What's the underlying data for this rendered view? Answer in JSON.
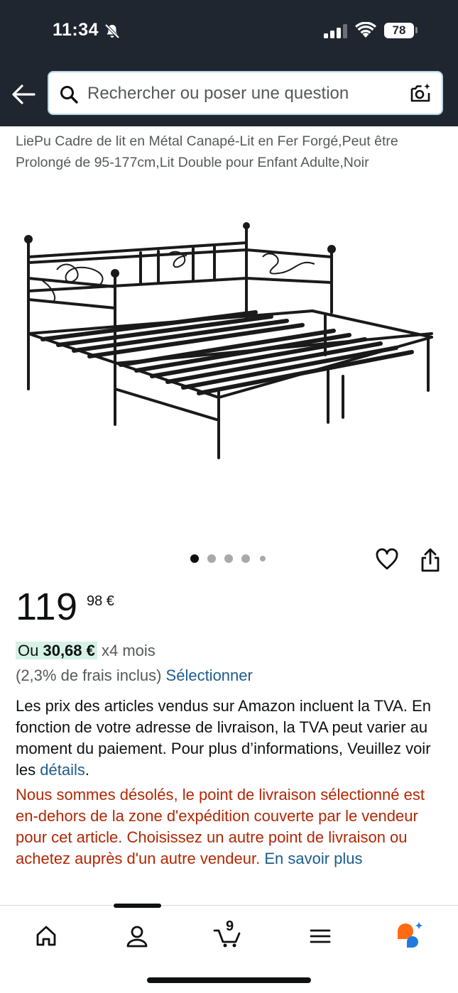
{
  "status_bar": {
    "time": "11:34",
    "battery": "78"
  },
  "search": {
    "placeholder": "Rechercher ou poser une question"
  },
  "product": {
    "title": "LiePu Cadre de lit en Métal Canapé-Lit en Fer Forgé,Peut être Prolongé de 95-177cm,Lit Double pour Enfant Adulte,Noir",
    "image_count": 5,
    "image_index": 1
  },
  "price": {
    "whole": "119",
    "cents": "98 €"
  },
  "installment": {
    "prefix": "Ou ",
    "amount": "30,68 €",
    "suffix": " x4 mois",
    "fees": "(2,3% de frais inclus) ",
    "select_link": "Sélectionner"
  },
  "vat_notice": {
    "text": "Les prix des articles vendus sur Amazon incluent la TVA. En fonction de votre adresse de livraison, la TVA peut varier au moment du paiement. Pour plus d’informations, Veuillez voir les ",
    "link": "détails",
    "end": "."
  },
  "delivery_warning": {
    "text": "Nous sommes désolés, le point de livraison sélectionné est en-dehors de la zone d'expédition couverte par le vendeur pour cet article. Choisissez un autre point de livraison ou achetez auprès d'un autre vendeur. ",
    "link": "En savoir plus"
  },
  "bottom_nav": {
    "cart_count": "9",
    "items": [
      "home-icon",
      "account-icon",
      "cart-icon",
      "menu-icon",
      "rufus-icon"
    ]
  },
  "colors": {
    "header_bg": "#1f2630",
    "link": "#1d5b8e",
    "warning": "#b12704",
    "badge_bg": "#d6f1e6",
    "rufus_orange": "#ff6a13",
    "rufus_blue": "#1f7ae0"
  }
}
